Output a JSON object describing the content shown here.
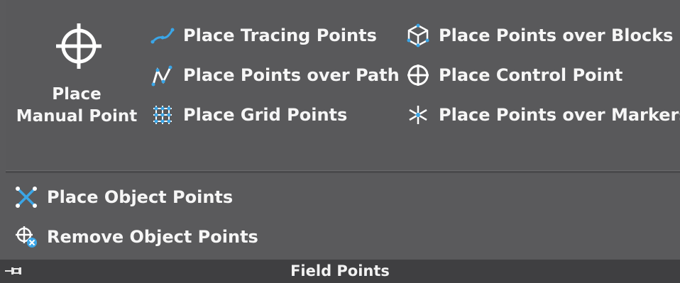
{
  "ribbon": {
    "panel_title": "Field Points",
    "big_button": {
      "line1": "Place",
      "line2": "Manual Point"
    },
    "column1": [
      {
        "label": "Place Tracing Points"
      },
      {
        "label": "Place Points over Path"
      },
      {
        "label": "Place Grid Points"
      }
    ],
    "column2": [
      {
        "label": "Place Points over Blocks"
      },
      {
        "label": "Place Control Point"
      },
      {
        "label": "Place Points over Markers"
      }
    ],
    "bottom": [
      {
        "label": "Place Object Points"
      },
      {
        "label": "Remove Object Points"
      }
    ]
  },
  "colors": {
    "panel_bg": "#5a5a5c",
    "footer_bg": "#3f3f41",
    "accent_blue": "#3aa6e8",
    "text": "#f6f6f6"
  },
  "icons": [
    "crosshair-icon",
    "tracing-points-icon",
    "path-points-icon",
    "grid-points-icon",
    "blocks-points-icon",
    "control-point-icon",
    "markers-points-icon",
    "object-points-icon",
    "remove-object-points-icon",
    "pin-icon"
  ]
}
